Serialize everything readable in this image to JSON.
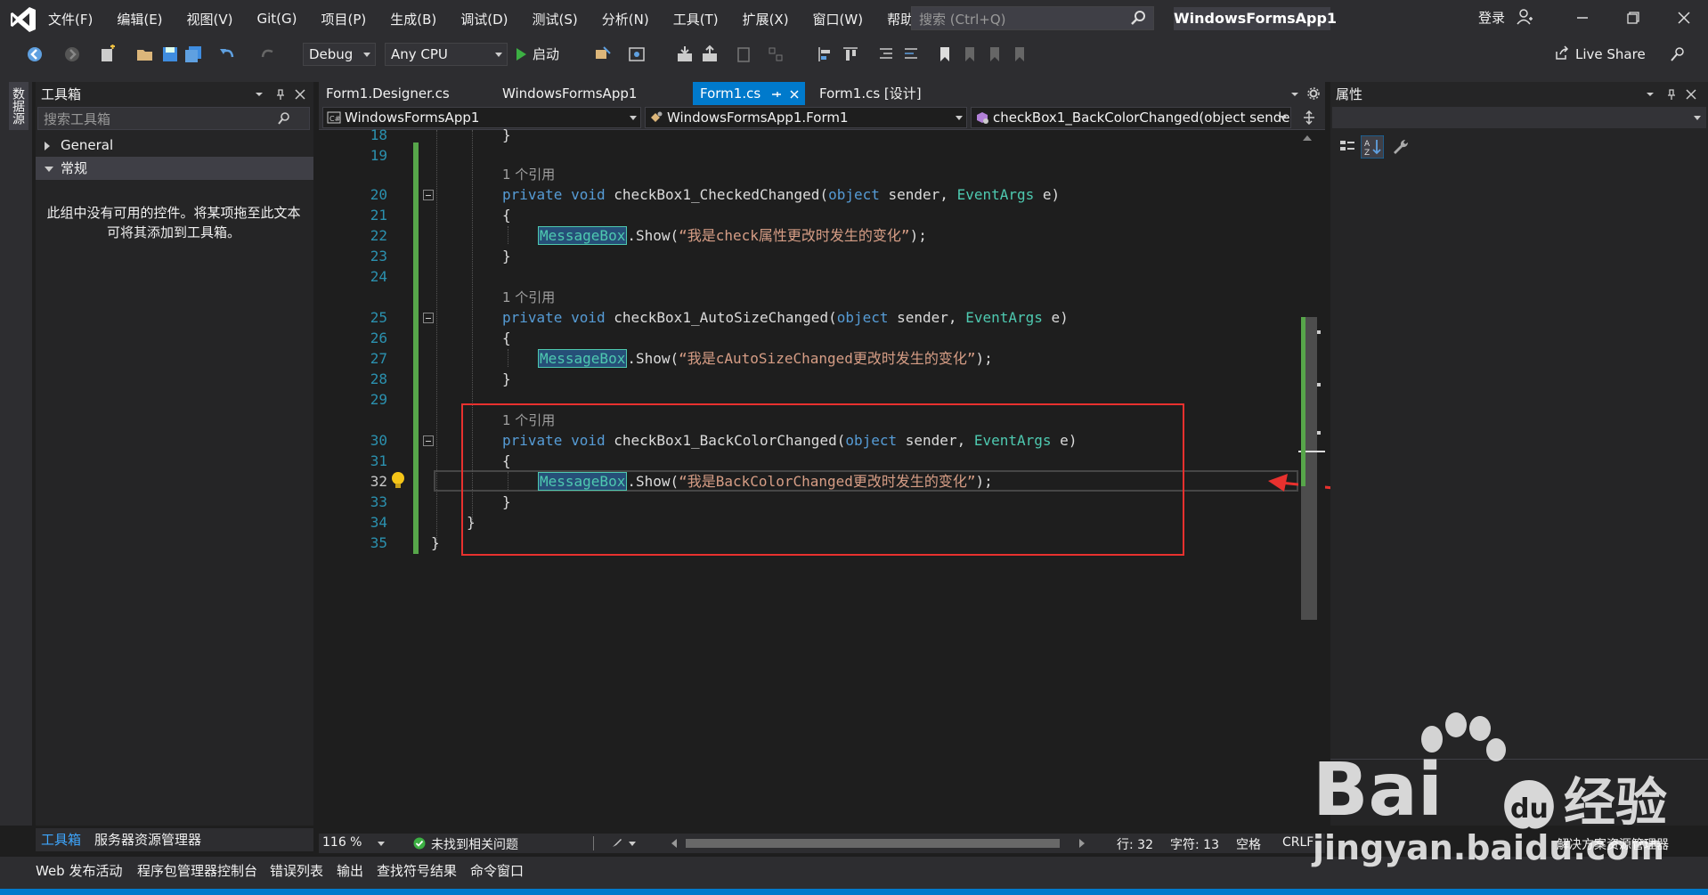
{
  "menubar": {
    "items": [
      "文件(F)",
      "编辑(E)",
      "视图(V)",
      "Git(G)",
      "项目(P)",
      "生成(B)",
      "调试(D)",
      "测试(S)",
      "分析(N)",
      "工具(T)",
      "扩展(X)",
      "窗口(W)",
      "帮助(H)"
    ],
    "search_placeholder": "搜索 (Ctrl+Q)",
    "app_title": "WindowsFormsApp1",
    "login": "登录"
  },
  "toolbar": {
    "config": "Debug",
    "platform": "Any CPU",
    "start": "启动",
    "live_share": "Live Share"
  },
  "left_strip": {
    "label": "数据源"
  },
  "toolbox": {
    "title": "工具箱",
    "search_placeholder": "搜索工具箱",
    "groups": [
      "General",
      "常规"
    ],
    "empty_message": "此组中没有可用的控件。将某项拖至此文本可将其添加到工具箱。",
    "bottom_tabs": [
      "工具箱",
      "服务器资源管理器"
    ]
  },
  "editor": {
    "tabs": [
      "Form1.Designer.cs",
      "WindowsFormsApp1",
      "Form1.cs",
      "Form1.cs [设计]"
    ],
    "nav": [
      "WindowsFormsApp1",
      "WindowsFormsApp1.Form1",
      "checkBox1_BackColorChanged(object sender"
    ],
    "line_numbers": [
      "18",
      "19",
      "20",
      "21",
      "22",
      "23",
      "24",
      "25",
      "26",
      "27",
      "28",
      "29",
      "30",
      "31",
      "32",
      "33",
      "34",
      "35"
    ],
    "ref_label": "1 个引用",
    "code": {
      "l18": "}",
      "kw_private": "private",
      "kw_void": "void",
      "kw_object": "object",
      "ty_eventargs": "EventArgs",
      "ty_messagebox": "MessageBox",
      "show": ".Show(",
      "end": ");",
      "brace_open": "{",
      "brace_close": "}",
      "m1": "checkBox1_CheckedChanged(",
      "m2": "checkBox1_AutoSizeChanged(",
      "m3": "checkBox1_BackColorChanged(",
      "params_mid": " sender, ",
      "params_end": " e)",
      "s1": "“我是check属性更改时发生的变化”",
      "s2": "“我是cAutoSizeChanged更改时发生的变化”",
      "s3": "“我是BackColorChanged更改时发生的变化”"
    }
  },
  "properties": {
    "title": "属性"
  },
  "status": {
    "zoom": "116 %",
    "issues": "未找到相关问题",
    "line": "行: 32",
    "col": "字符: 13",
    "space": "空格",
    "eol": "CRLF",
    "right_tabs": [
      "解决方案资源管理器"
    ]
  },
  "bottom_windows": [
    "Web 发布活动",
    "程序包管理器控制台",
    "错误列表",
    "输出",
    "查找符号结果",
    "命令窗口"
  ],
  "watermark": {
    "brand": "Bai",
    "brand2": "经验",
    "url": "jingyan.baidu.com"
  },
  "colors": {
    "accent": "#007acc",
    "annotation": "#e8312e"
  }
}
